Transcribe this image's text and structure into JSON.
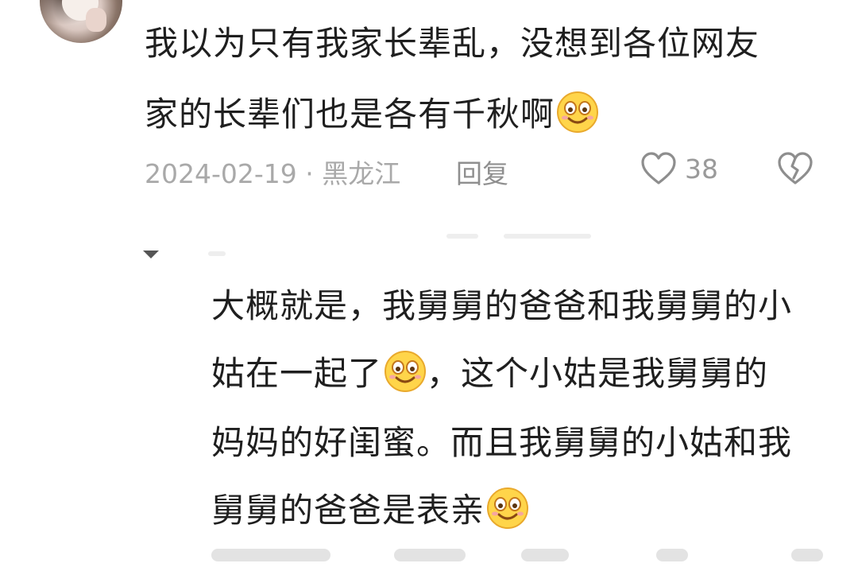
{
  "comment": {
    "line1": "我以为只有我家长辈乱，没想到各位网友",
    "line2": "家的长辈们也是各有千秋啊",
    "emoji": "smile-emoji",
    "date_location": "2024-02-19 · 黑龙江",
    "reply_label": "回复",
    "like_count": "38"
  },
  "reply": {
    "line1": "大概就是，我舅舅的爸爸和我舅舅的小",
    "line2_a": "姑在一起了",
    "line2_b": "，这个小姑是我舅舅的",
    "line3": "妈妈的好闺蜜。而且我舅舅的小姑和我",
    "line4": "舅舅的爸爸是表亲"
  },
  "colors": {
    "text": "#1f1f1f",
    "meta": "#a9a9a9",
    "icon": "#8e8e8e",
    "emoji_face": "#ffd54a"
  }
}
